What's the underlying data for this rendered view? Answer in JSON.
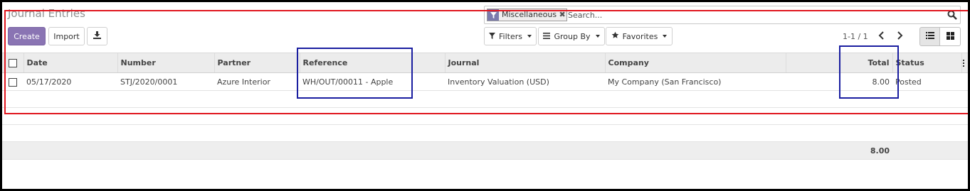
{
  "page": {
    "title": "Journal Entries"
  },
  "search": {
    "facet_label": "Miscellaneous",
    "facet_icon": "filter-icon",
    "facet_remove": "✖",
    "placeholder": "Search..."
  },
  "toolbar": {
    "create_label": "Create",
    "import_label": "Import",
    "download_icon": "download-icon",
    "filters_label": "Filters",
    "groupby_label": "Group By",
    "favorites_label": "Favorites"
  },
  "pager": {
    "value": "1-1 / 1"
  },
  "table": {
    "headers": {
      "date": "Date",
      "number": "Number",
      "partner": "Partner",
      "reference": "Reference",
      "journal": "Journal",
      "company": "Company",
      "total": "Total",
      "status": "Status"
    },
    "rows": [
      {
        "date": "05/17/2020",
        "number": "STJ/2020/0001",
        "partner": "Azure Interior",
        "reference": "WH/OUT/00011 - Apple",
        "journal": "Inventory Valuation (USD)",
        "company": "My Company (San Francisco)",
        "total": "8.00",
        "status": "Posted"
      }
    ],
    "footer_total": "8.00"
  },
  "colors": {
    "primary": "#8a74b3",
    "facet_icon_bg": "#7c7bad",
    "highlight_red": "#e0161e",
    "highlight_blue": "#1a1ea0"
  }
}
